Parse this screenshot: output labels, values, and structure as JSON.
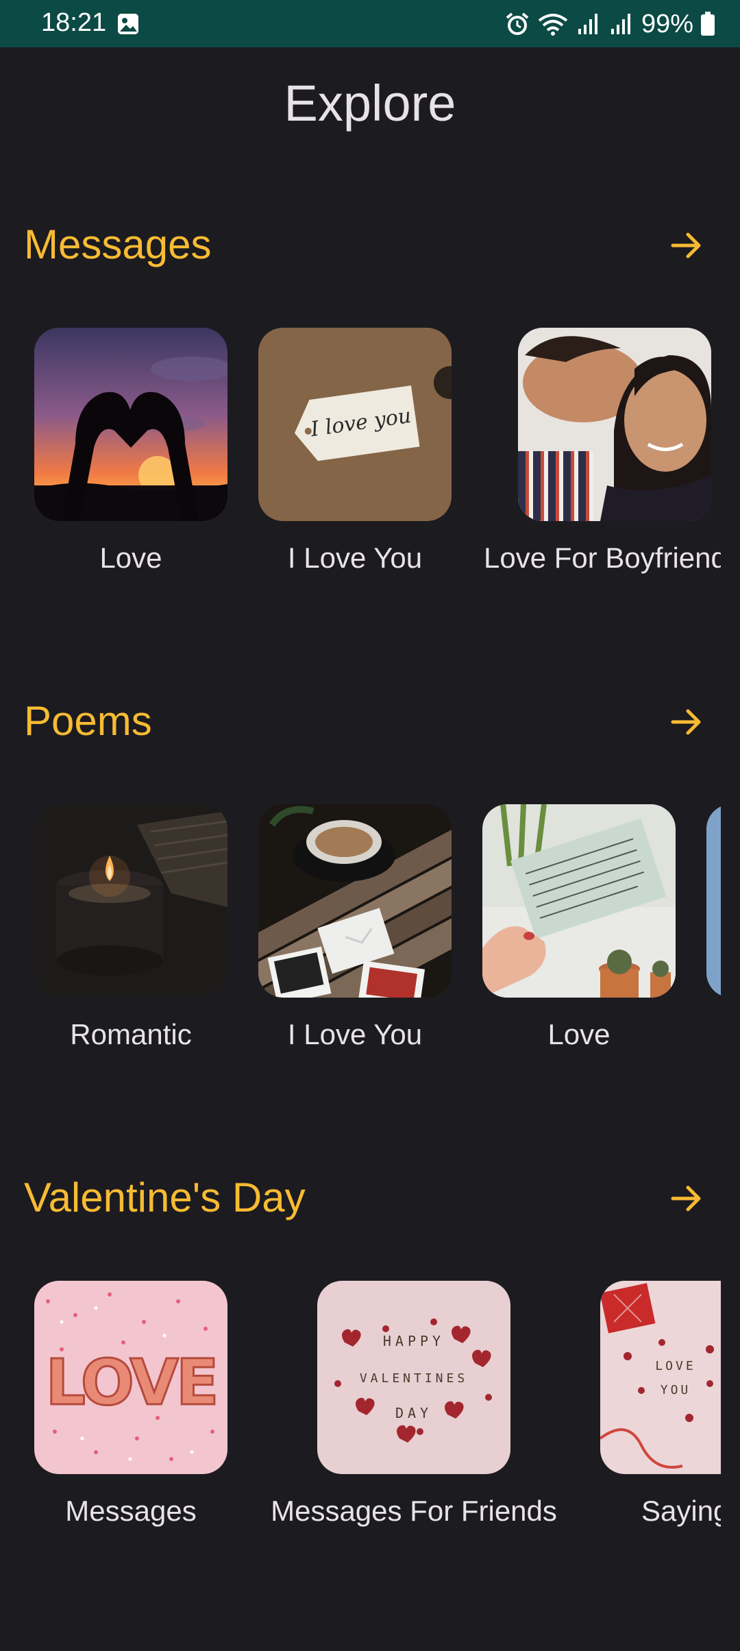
{
  "status_bar": {
    "time": "18:21",
    "battery": "99%"
  },
  "page": {
    "title": "Explore"
  },
  "sections": [
    {
      "title": "Messages",
      "items": [
        {
          "label": "Love"
        },
        {
          "label": "I Love You"
        },
        {
          "label": "Love For Boyfriend"
        }
      ]
    },
    {
      "title": "Poems",
      "items": [
        {
          "label": "Romantic"
        },
        {
          "label": "I Love You"
        },
        {
          "label": "Love"
        }
      ]
    },
    {
      "title": "Valentine's Day",
      "items": [
        {
          "label": "Messages"
        },
        {
          "label": "Messages For Friends"
        },
        {
          "label": "Sayings"
        }
      ]
    }
  ],
  "image_text": {
    "tag": "I love you",
    "love_cookie": "LOVE",
    "tiles_happy": "HAPPY",
    "tiles_valentines": "VALENTINES",
    "tiles_day": "DAY",
    "tiles_love": "LOVE",
    "tiles_you": "YOU"
  },
  "colors": {
    "accent": "#f7bb33",
    "background": "#1c1b20",
    "status_bar": "#0c4a45"
  },
  "icons": [
    "gallery-icon",
    "alarm-icon",
    "wifi-icon",
    "signal-icon",
    "battery-icon",
    "arrow-right-icon"
  ]
}
